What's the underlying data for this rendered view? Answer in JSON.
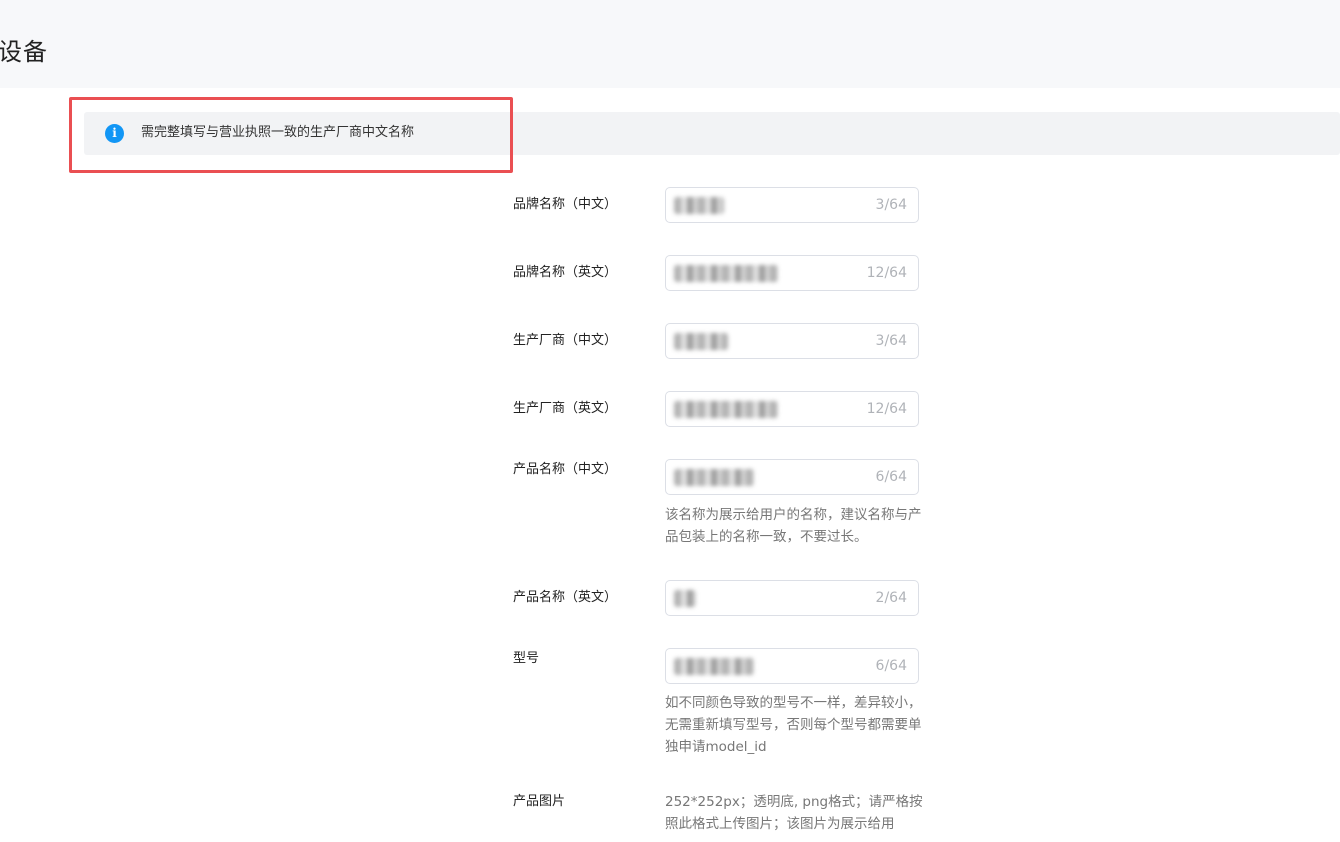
{
  "header": {
    "title": "设备"
  },
  "alert": {
    "icon": "info-icon",
    "icon_glyph": "i",
    "text": "需完整填写与营业执照一致的生产厂商中文名称"
  },
  "fields": [
    {
      "label": "品牌名称（中文）",
      "counter": "3/64"
    },
    {
      "label": "品牌名称（英文）",
      "counter": "12/64"
    },
    {
      "label": "生产厂商（中文）",
      "counter": "3/64"
    },
    {
      "label": "生产厂商（英文）",
      "counter": "12/64"
    },
    {
      "label": "产品名称（中文）",
      "counter": "6/64",
      "help": "该名称为展示给用户的名称，建议名称与产品包装上的名称一致，不要过长。"
    },
    {
      "label": "产品名称（英文）",
      "counter": "2/64"
    },
    {
      "label": "型号",
      "counter": "6/64",
      "help": "如不同颜色导致的型号不一样，差异较小，无需重新填写型号，否则每个型号都需要单独申请model_id"
    },
    {
      "label": "产品图片",
      "help": "252*252px；透明底, png格式；请严格按照此格式上传图片；该图片为展示给用"
    }
  ],
  "colors": {
    "accent": "#1296f5",
    "highlight": "#ea4f52"
  }
}
